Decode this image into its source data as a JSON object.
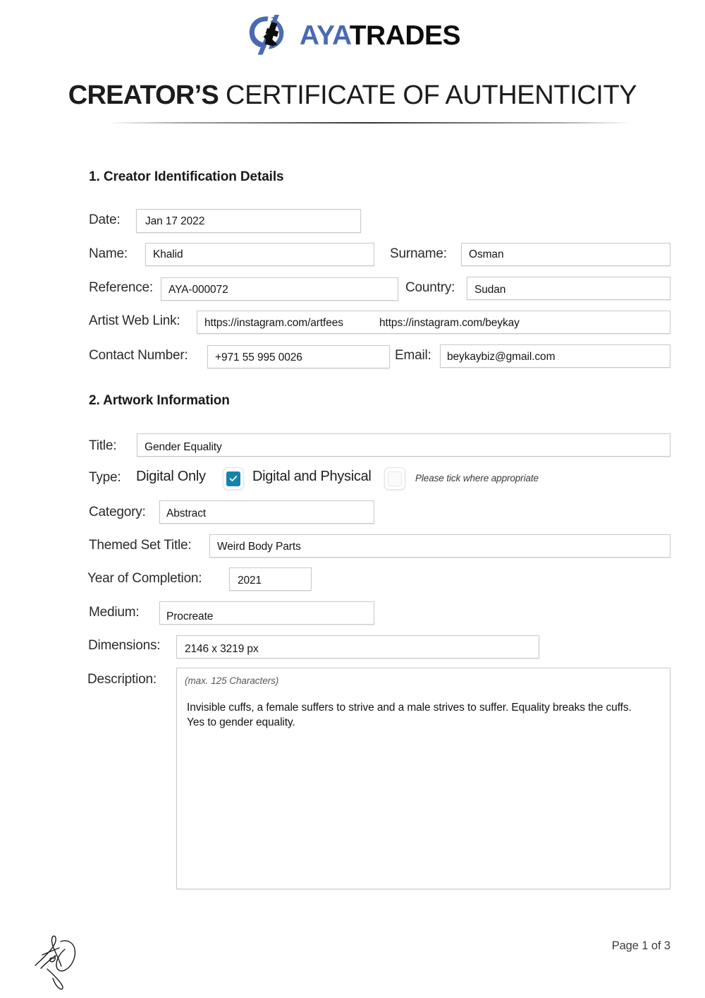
{
  "brand": {
    "logo_icon": "ayatrades-logo-mark",
    "name_part1": "AYA",
    "name_part2": "TRADES",
    "accent_color": "#4a6bb0",
    "text_color": "#0d0d0d"
  },
  "document": {
    "title_strong": "CREATOR’S",
    "title_rest": " CERTIFICATE OF AUTHENTICITY"
  },
  "section1": {
    "heading": "1. Creator Identification Details",
    "date": {
      "label": "Date:",
      "value": "Jan 17 2022"
    },
    "name": {
      "label": "Name:",
      "value": "Khalid"
    },
    "surname": {
      "label": "Surname:",
      "value": "Osman"
    },
    "reference": {
      "label": "Reference:",
      "value": "AYA-000072"
    },
    "country": {
      "label": "Country:",
      "value": "Sudan"
    },
    "web_link": {
      "label": "Artist Web Link:",
      "value1": "https://instagram.com/artfees",
      "value2": "https://instagram.com/beykay"
    },
    "contact_number": {
      "label": "Contact Number:",
      "value": "+971 55 995 0026"
    },
    "email": {
      "label": "Email:",
      "value": "beykaybiz@gmail.com"
    }
  },
  "section2": {
    "heading": "2. Artwork Information",
    "title": {
      "label": "Title:",
      "value": "Gender Equality"
    },
    "type": {
      "label": "Type:",
      "option_digital_only": "Digital Only",
      "option_digital_physical": "Digital and Physical",
      "digital_only_checked": true,
      "digital_physical_checked": false,
      "note": "Please tick where appropriate",
      "checked_color": "#1683ad"
    },
    "category": {
      "label": "Category:",
      "value": "Abstract"
    },
    "themed_set_title": {
      "label": "Themed Set Title:",
      "value": "Weird Body Parts"
    },
    "year_of_completion": {
      "label": "Year of Completion:",
      "value": "2021"
    },
    "medium": {
      "label": "Medium:",
      "value": "Procreate"
    },
    "dimensions": {
      "label": "Dimensions:",
      "value": "2146 x 3219 px"
    },
    "description": {
      "label": "Description:",
      "hint": "(max. 125 Characters)",
      "value": "Invisible cuffs, a female suffers to strive and a male strives to suffer. Equality breaks the cuffs. Yes to gender equality."
    }
  },
  "footer": {
    "signature_icon": "handwritten-signature-ko",
    "page_indicator": "Page 1 of 3"
  }
}
